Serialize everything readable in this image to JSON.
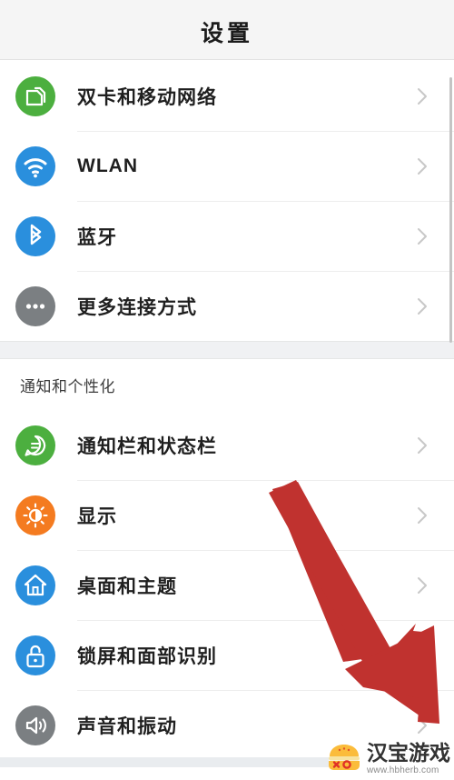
{
  "header": {
    "title": "设置"
  },
  "colors": {
    "header_bg": "#f5f5f5",
    "page_bg": "#ffffff",
    "group_gap_bg": "#f0f1f3",
    "separator": "#ededed",
    "chevron": "#c8c8c8",
    "label_text": "#1f1f1f",
    "section_text": "#3c3c3c",
    "arrow_red": "#c0322f",
    "icon_green": "#4caf3f",
    "icon_blue": "#2a8fdd",
    "icon_gray": "#7b7f82",
    "icon_orange": "#f47b20",
    "scrollbar": "#c4c4c4"
  },
  "groups": [
    {
      "id": "connectivity",
      "section_label": null,
      "rows": [
        {
          "label": "双卡和移动网络",
          "icon": "sim-card-icon",
          "icon_color": "#4caf3f",
          "chevron": "chevron-right-icon"
        },
        {
          "label": "WLAN",
          "icon": "wifi-icon",
          "icon_color": "#2a8fdd",
          "chevron": "chevron-right-icon"
        },
        {
          "label": "蓝牙",
          "icon": "bluetooth-icon",
          "icon_color": "#2a8fdd",
          "chevron": "chevron-right-icon"
        },
        {
          "label": "更多连接方式",
          "icon": "more-dots-icon",
          "icon_color": "#7b7f82",
          "chevron": "chevron-right-icon"
        }
      ]
    },
    {
      "id": "notifications-personalization",
      "section_label": "通知和个性化",
      "rows": [
        {
          "label": "通知栏和状态栏",
          "icon": "chat-bubble-icon",
          "icon_color": "#4caf3f",
          "chevron": "chevron-right-icon"
        },
        {
          "label": "显示",
          "icon": "brightness-icon",
          "icon_color": "#f47b20",
          "chevron": "chevron-right-icon"
        },
        {
          "label": "桌面和主题",
          "icon": "home-icon",
          "icon_color": "#2a8fdd",
          "chevron": "chevron-right-icon"
        },
        {
          "label": "锁屏和面部识别",
          "icon": "lock-open-icon",
          "icon_color": "#2a8fdd",
          "chevron": "chevron-right-icon"
        },
        {
          "label": "声音和振动",
          "icon": "speaker-icon",
          "icon_color": "#7b7f82",
          "chevron": "chevron-right-icon"
        }
      ]
    }
  ],
  "annotation": {
    "type": "arrow",
    "direction": "down-right",
    "color": "#c0322f"
  },
  "watermark": {
    "title": "汉宝游戏",
    "url": "www.hbherb.com",
    "mark": "burger-logo-icon"
  }
}
